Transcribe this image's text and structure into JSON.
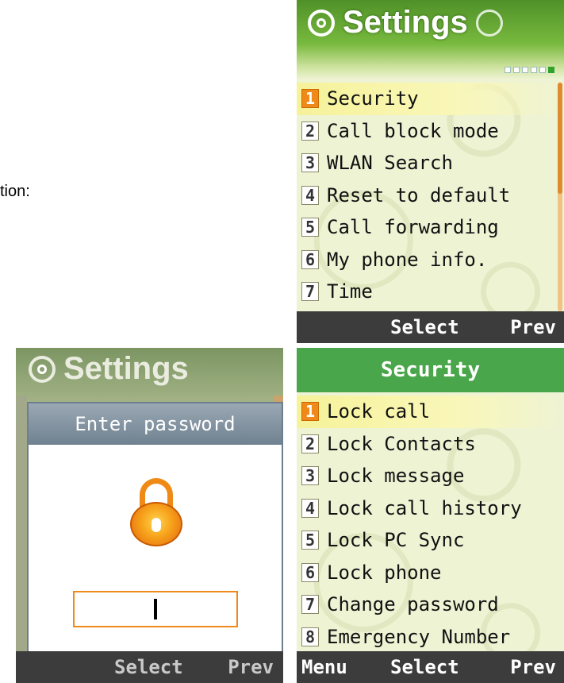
{
  "page": {
    "intro_text": "tion:"
  },
  "settings_screen": {
    "title": "Settings",
    "menu": [
      {
        "num": "1",
        "label": "Security"
      },
      {
        "num": "2",
        "label": "Call block mode"
      },
      {
        "num": "3",
        "label": "WLAN Search"
      },
      {
        "num": "4",
        "label": "Reset to default"
      },
      {
        "num": "5",
        "label": "Call forwarding"
      },
      {
        "num": "6",
        "label": "My phone info."
      },
      {
        "num": "7",
        "label": "Time"
      }
    ],
    "softkeys": {
      "select": "Select",
      "prev": "Prev"
    },
    "accent_color": "#ef8a1a",
    "header_color": "#4f9128"
  },
  "password_screen": {
    "title": "Settings",
    "dialog_title": "Enter password",
    "input_value": "",
    "softkeys": {
      "select": "Select",
      "prev": "Prev"
    },
    "lock_icon": "padlock-icon"
  },
  "security_screen": {
    "title": "Security",
    "menu": [
      {
        "num": "1",
        "label": "Lock call"
      },
      {
        "num": "2",
        "label": "Lock Contacts"
      },
      {
        "num": "3",
        "label": "Lock message"
      },
      {
        "num": "4",
        "label": "Lock call history"
      },
      {
        "num": "5",
        "label": "Lock PC Sync"
      },
      {
        "num": "6",
        "label": "Lock phone"
      },
      {
        "num": "7",
        "label": "Change password"
      },
      {
        "num": "8",
        "label": "Emergency Number"
      }
    ],
    "softkeys": {
      "menu": "Menu",
      "select": "Select",
      "prev": "Prev"
    },
    "header_color": "#4aa64a"
  }
}
